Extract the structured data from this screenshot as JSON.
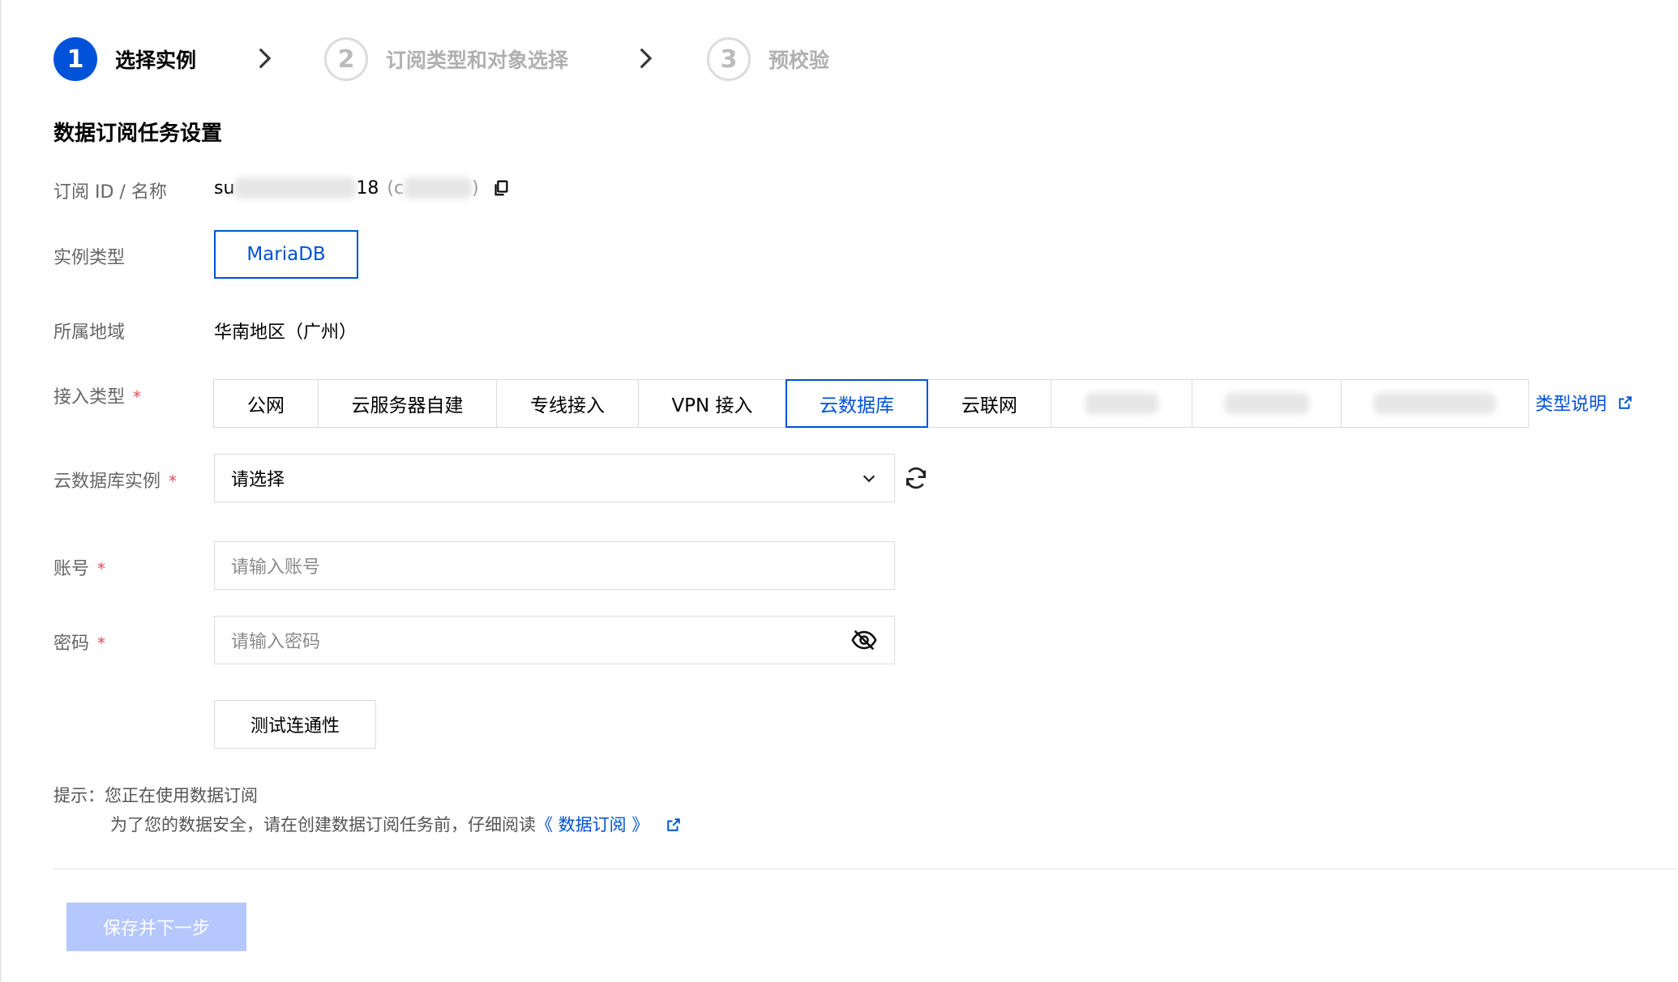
{
  "steps": [
    {
      "number": "1",
      "label": "选择实例"
    },
    {
      "number": "2",
      "label": "订阅类型和对象选择"
    },
    {
      "number": "3",
      "label": "预校验"
    }
  ],
  "section_title": "数据订阅任务设置",
  "form": {
    "subscription": {
      "label": "订阅 ID / 名称",
      "id_prefix": "su",
      "id_suffix": "18",
      "name_prefix": "(c",
      "name_suffix": ")"
    },
    "instance_type": {
      "label": "实例类型",
      "value": "MariaDB"
    },
    "region": {
      "label": "所属地域",
      "value": "华南地区（广州）"
    },
    "access_type": {
      "label": "接入类型",
      "required_mark": "*",
      "options": [
        "公网",
        "云服务器自建",
        "专线接入",
        "VPN 接入",
        "云数据库",
        "云联网"
      ],
      "selected": "云数据库",
      "help_link": "类型说明"
    },
    "db_instance": {
      "label": "云数据库实例",
      "required_mark": "*",
      "value": "请选择"
    },
    "account": {
      "label": "账号",
      "required_mark": "*",
      "placeholder": "请输入账号"
    },
    "password": {
      "label": "密码",
      "required_mark": "*",
      "placeholder": "请输入密码"
    },
    "test_button": "测试连通性"
  },
  "tips": {
    "prefix": "提示：",
    "line1": "您正在使用数据订阅",
    "line2_text": "为了您的数据安全，请在创建数据订阅任务前，仔细阅读",
    "line2_link": "《 数据订阅 》"
  },
  "footer": {
    "save_button": "保存并下一步"
  },
  "colors": {
    "primary": "#0052d9",
    "required": "#e34d59",
    "disabled_button": "#b5c7ff",
    "border": "#dcdcdc"
  }
}
